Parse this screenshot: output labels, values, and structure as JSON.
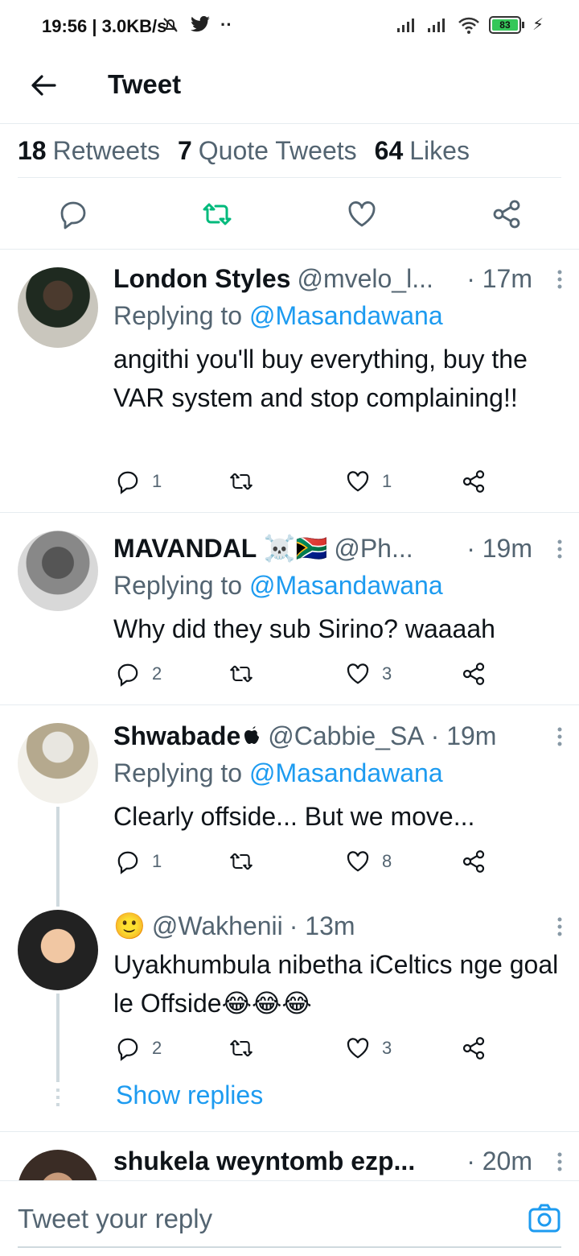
{
  "status_bar": {
    "time": "19:56",
    "speed": "3.0KB/s",
    "battery": "83"
  },
  "header": {
    "title": "Tweet"
  },
  "stats": [
    {
      "count": "18",
      "label": "Retweets"
    },
    {
      "count": "7",
      "label": "Quote Tweets"
    },
    {
      "count": "64",
      "label": "Likes"
    }
  ],
  "colors": {
    "accent": "#1d9bf0",
    "retweet_green": "#00ba7c",
    "muted": "#536471"
  },
  "tweets": [
    {
      "name": "London Styles",
      "handle": "@mvelo_l...",
      "time": "· 17m",
      "replying_prefix": "Replying to ",
      "replying_to": "@Masandawana",
      "text": "angithi you'll buy everything, buy the VAR system and stop complaining!!",
      "replies": "1",
      "retweets": "",
      "likes": "1"
    },
    {
      "name": "MAVANDAL ☠️🇿🇦",
      "handle": "@Ph...",
      "time": "· 19m",
      "replying_prefix": "Replying to ",
      "replying_to": "@Masandawana",
      "text": "Why did they sub Sirino? waaaah",
      "replies": "2",
      "retweets": "",
      "likes": "3"
    },
    {
      "name": "Shwabade",
      "handle": "@Cabbie_SA",
      "time": "· 19m",
      "replying_prefix": "Replying to ",
      "replying_to": "@Masandawana",
      "text": "Clearly offside... But we move...",
      "replies": "1",
      "retweets": "",
      "likes": "8"
    },
    {
      "name": "🙂",
      "handle": "@Wakhenii",
      "time": "· 13m",
      "text": "Uyakhumbula nibetha iCeltics nge goal le Offside😂😂😂",
      "replies": "2",
      "retweets": "",
      "likes": "3"
    },
    {
      "name": "shukela weyntomb ezp...",
      "handle": "",
      "time": "· 20m"
    }
  ],
  "show_replies": "Show replies",
  "reply_bar": {
    "placeholder": "Tweet your reply"
  }
}
